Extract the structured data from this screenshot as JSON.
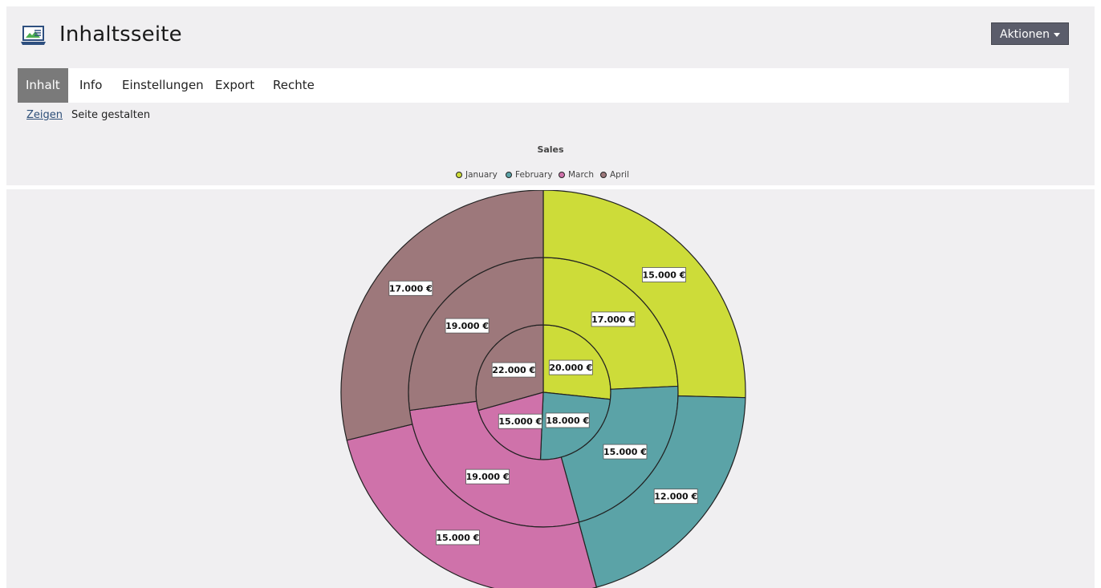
{
  "header": {
    "title": "Inhaltsseite",
    "actions_label": "Aktionen"
  },
  "tabs": [
    {
      "label": "Inhalt",
      "active": true
    },
    {
      "label": "Info",
      "active": false
    },
    {
      "label": "Einstellungen",
      "active": false
    },
    {
      "label": "Export",
      "active": false
    },
    {
      "label": "Rechte",
      "active": false
    }
  ],
  "subtabs": [
    {
      "label": "Zeigen",
      "active": true
    },
    {
      "label": "Seite gestalten",
      "active": false
    }
  ],
  "colors": {
    "accent_tab": "#7a7a7a",
    "actions_button": "#5b5d6b",
    "link": "#2d4e78"
  },
  "icons": {
    "page": "presentation-laptop-icon",
    "actions_caret": "caret-down-icon"
  },
  "chart_data": {
    "type": "pie",
    "title": "Sales",
    "legend_position": "top",
    "categories": [
      "January",
      "February",
      "March",
      "April"
    ],
    "colors": [
      "#cddc39",
      "#5ba3a7",
      "#cf72aa",
      "#9d787b"
    ],
    "series": [
      {
        "values": [
          20000,
          18000,
          15000,
          22000
        ],
        "labels": [
          "20.000 €",
          "18.000 €",
          "15.000 €",
          "22.000 €"
        ]
      },
      {
        "values": [
          17000,
          15000,
          19000,
          19000
        ],
        "labels": [
          "17.000 €",
          "15.000 €",
          "19.000 €",
          "19.000 €"
        ]
      },
      {
        "values": [
          15000,
          12000,
          15000,
          17000
        ],
        "labels": [
          "15.000 €",
          "12.000 €",
          "15.000 €",
          "17.000 €"
        ]
      }
    ]
  }
}
